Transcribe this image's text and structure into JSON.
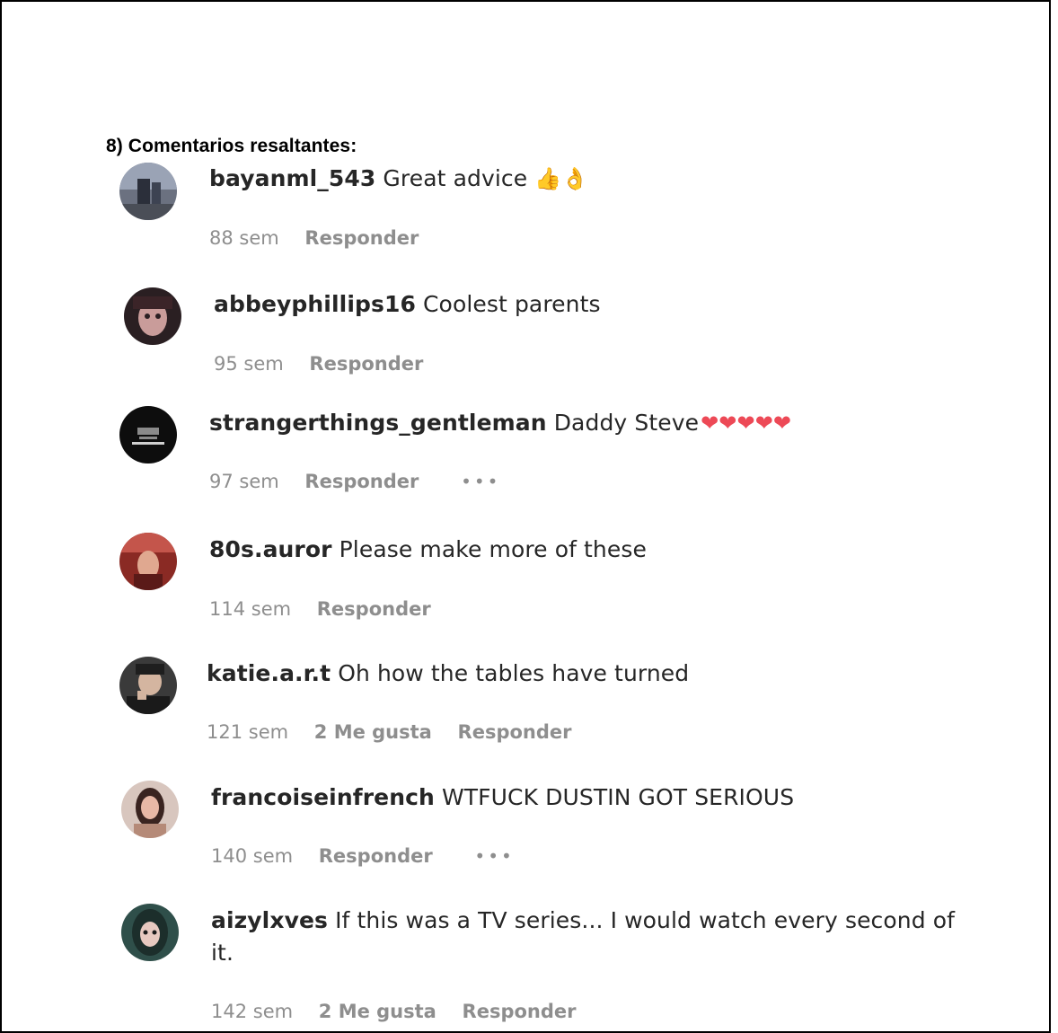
{
  "heading": "8) Comentarios resaltantes:",
  "comments": [
    {
      "user": "bayanml_543",
      "text": "Great advice",
      "emoji": "👍👌",
      "time": "88 sem",
      "likes": "",
      "reply": "Responder",
      "more": false
    },
    {
      "user": "abbeyphillips16",
      "text": "Coolest parents",
      "time": "95 sem",
      "likes": "",
      "reply": "Responder",
      "more": false
    },
    {
      "user": "strangerthings_gentleman",
      "text": "Daddy Steve",
      "emoji": "❤❤❤❤❤",
      "time": "97 sem",
      "likes": "",
      "reply": "Responder",
      "more": true
    },
    {
      "user": "80s.auror",
      "text": "Please make more of these",
      "time": "114 sem",
      "likes": "",
      "reply": "Responder",
      "more": false
    },
    {
      "user": "katie.a.r.t",
      "text": "Oh how the tables have turned",
      "time": "121 sem",
      "likes": "2 Me gusta",
      "reply": "Responder",
      "more": false
    },
    {
      "user": "francoiseinfrench",
      "text": "WTFUCK DUSTIN GOT SERIOUS",
      "time": "140 sem",
      "likes": "",
      "reply": "Responder",
      "more": true
    },
    {
      "user": "aizylxves",
      "text": "If this was a TV series... I would watch every second of",
      "text2": "it.",
      "time": "142 sem",
      "likes": "2 Me gusta",
      "reply": "Responder",
      "more": false
    }
  ],
  "more_icon": "•••"
}
